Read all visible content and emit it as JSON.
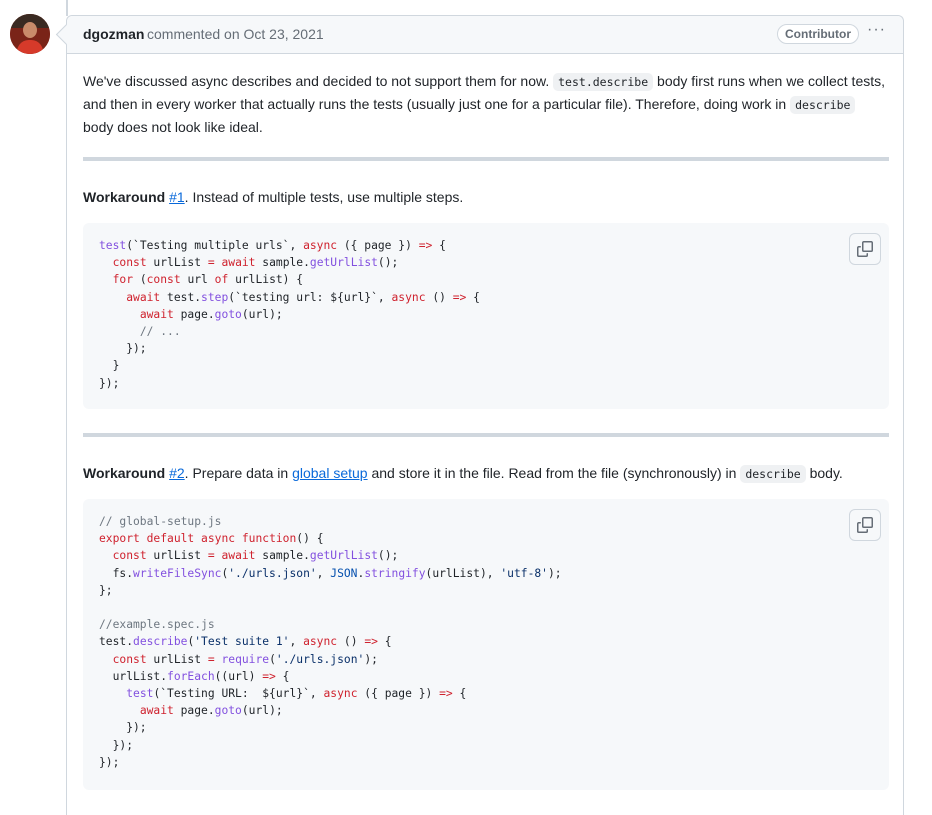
{
  "comment": {
    "author": "dgozman",
    "action": "commented on",
    "date": "Oct 23, 2021",
    "badge": "Contributor",
    "menu_label": "···"
  },
  "intro": {
    "t1": "We've discussed async describes and decided to not support them for now. ",
    "code1": "test.describe",
    "t2": " body first runs when we collect tests, and then in every worker that actually runs the tests (usually just one for a particular file). Therefore, doing work in ",
    "code2": "describe",
    "t3": " body does not look like ideal."
  },
  "workaround1": {
    "label": "Workaround",
    "ref": "#1",
    "text": ". Instead of multiple tests, use multiple steps."
  },
  "workaround2": {
    "label": "Workaround",
    "ref": "#2",
    "t1": ". Prepare data in ",
    "link": "global setup",
    "t2": " and store it in the file. Read from the file (synchronously) in ",
    "code": "describe",
    "t3": " body."
  },
  "icons": {
    "copy": "copy-icon",
    "kebab": "kebab-horizontal-icon"
  }
}
